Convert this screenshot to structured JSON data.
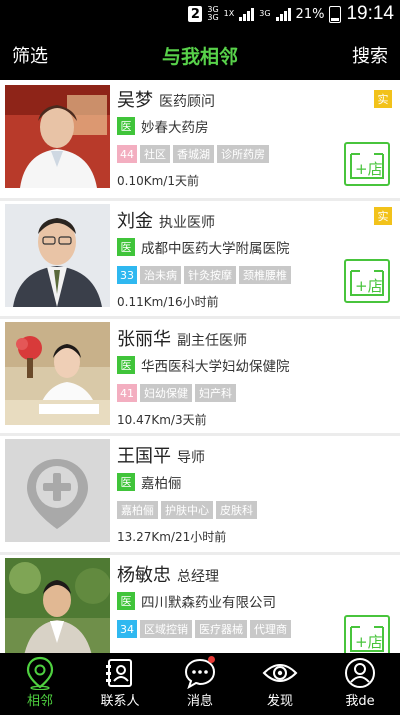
{
  "statusbar": {
    "sim": "2",
    "net1": "3G",
    "net2": "3G",
    "net3": "1X",
    "net4": "3G",
    "battery": "21%",
    "time": "19:14"
  },
  "header": {
    "left": "筛选",
    "title": "与我相邻",
    "right": "搜索"
  },
  "badges": {
    "shi": "实",
    "yi": "医"
  },
  "colors": {
    "green": "#40c43a",
    "yellow": "#f2c21a",
    "pink": "#f3aec0",
    "blue": "#2fb8f0",
    "tag_gray": "#c8c8c8"
  },
  "cards": [
    {
      "name": "吴梦",
      "title": "医药顾问",
      "org": "妙春大药房",
      "count": "44",
      "count_color": "#f3aec0",
      "tags": [
        "社区",
        "香城湖",
        "诊所药房"
      ],
      "dist": "0.10Km/1天前",
      "shi": true,
      "store": true
    },
    {
      "name": "刘金",
      "title": "执业医师",
      "org": "成都中医药大学附属医院",
      "count": "33",
      "count_color": "#2fb8f0",
      "tags": [
        "治未病",
        "针灸按摩",
        "颈椎腰椎"
      ],
      "dist": "0.11Km/16小时前",
      "shi": true,
      "store": true
    },
    {
      "name": "张丽华",
      "title": "副主任医师",
      "org": "华西医科大学妇幼保健院",
      "count": "41",
      "count_color": "#f3aec0",
      "tags": [
        "妇幼保健",
        "妇产科"
      ],
      "dist": "10.47Km/3天前",
      "shi": false,
      "store": false
    },
    {
      "name": "王国平",
      "title": "导师",
      "org": "嘉柏俪",
      "count": "",
      "tags": [
        "嘉柏俪",
        "护肤中心",
        "皮肤科"
      ],
      "dist": "13.27Km/21小时前",
      "shi": false,
      "store": false
    },
    {
      "name": "杨敏忠",
      "title": "总经理",
      "org": "四川默森药业有限公司",
      "count": "34",
      "count_color": "#2fb8f0",
      "tags": [
        "区域控销",
        "医疗器械",
        "代理商"
      ],
      "dist": "",
      "shi": false,
      "store": true
    }
  ],
  "tabs": [
    {
      "label": "相邻",
      "icon": "location-pin-icon",
      "active": true
    },
    {
      "label": "联系人",
      "icon": "contacts-icon",
      "active": false
    },
    {
      "label": "消息",
      "icon": "chat-bubble-icon",
      "active": false,
      "dot": true
    },
    {
      "label": "发现",
      "icon": "eye-icon",
      "active": false
    },
    {
      "label": "我de",
      "icon": "user-icon",
      "active": false
    }
  ]
}
